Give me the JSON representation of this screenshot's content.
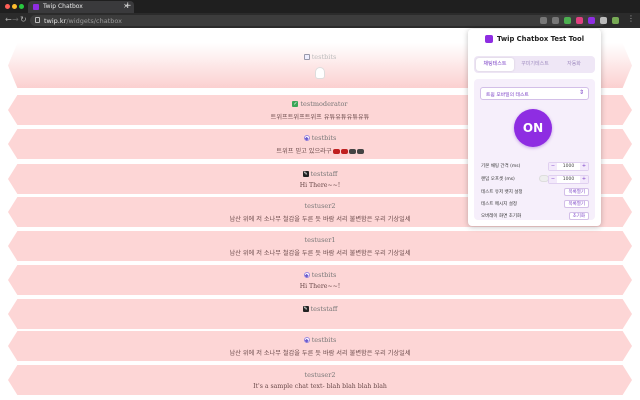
{
  "browser": {
    "tab_title": "Twip Chatbox",
    "tab_close": "×",
    "new_tab": "+",
    "url_host": "twip.kr",
    "url_path": "/widgets/chatbox"
  },
  "chat": {
    "messages": [
      {
        "user": "testbits",
        "text": ""
      },
      {
        "user": "testmoderator",
        "text": "트위프트위프트위프 유튜유튜유튜유튜"
      },
      {
        "user": "testbits",
        "text": "트위프 믿고 있으라구"
      },
      {
        "user": "teststaff",
        "text": "Hi There~~!"
      },
      {
        "user": "testuser2",
        "text": "남산 위에 저 소나무 철갑을 두른 듯 바람 서리 불변함은 우리 기상일세"
      },
      {
        "user": "testuser1",
        "text": "남산 위에 저 소나무 철갑을 두른 듯 바람 서리 불변함은 우리 기상일세"
      },
      {
        "user": "testbits",
        "text": "Hi There~~!"
      },
      {
        "user": "teststaff",
        "text": ""
      },
      {
        "user": "testbits",
        "text": "남산 위에 저 소나무 철갑을 두른 듯 바람 서리 불변함은 우리 기상일세"
      },
      {
        "user": "testuser2",
        "text": "It's a sample chat text- blah blah blah blah"
      }
    ]
  },
  "popup": {
    "title": "Twip Chatbox Test Tool",
    "tabs": [
      "채팅테스트",
      "꾸미기테스트",
      "자동화"
    ],
    "select_value": "트윕 모바일의 테스트",
    "on_label": "ON",
    "rows": {
      "base_interval": {
        "label": "기본 채팅 간격 (ms)",
        "value": "1000"
      },
      "random_offset": {
        "label": "랜덤 오프셋 (ms)",
        "value": "1000"
      },
      "test_user_badge": {
        "label": "테스트 유저 뱃지 설정",
        "action": "목록열기"
      },
      "test_message": {
        "label": "테스트 메시지 설정",
        "action": "목록열기"
      },
      "overlay_reset": {
        "label": "오버레이 화면 초기화",
        "action": "초기화"
      }
    },
    "minus": "−",
    "plus": "+"
  },
  "colors": {
    "accent": "#8e2de2",
    "chat_bg": "#fdd6d6",
    "chrome": "#1f1f1f"
  }
}
